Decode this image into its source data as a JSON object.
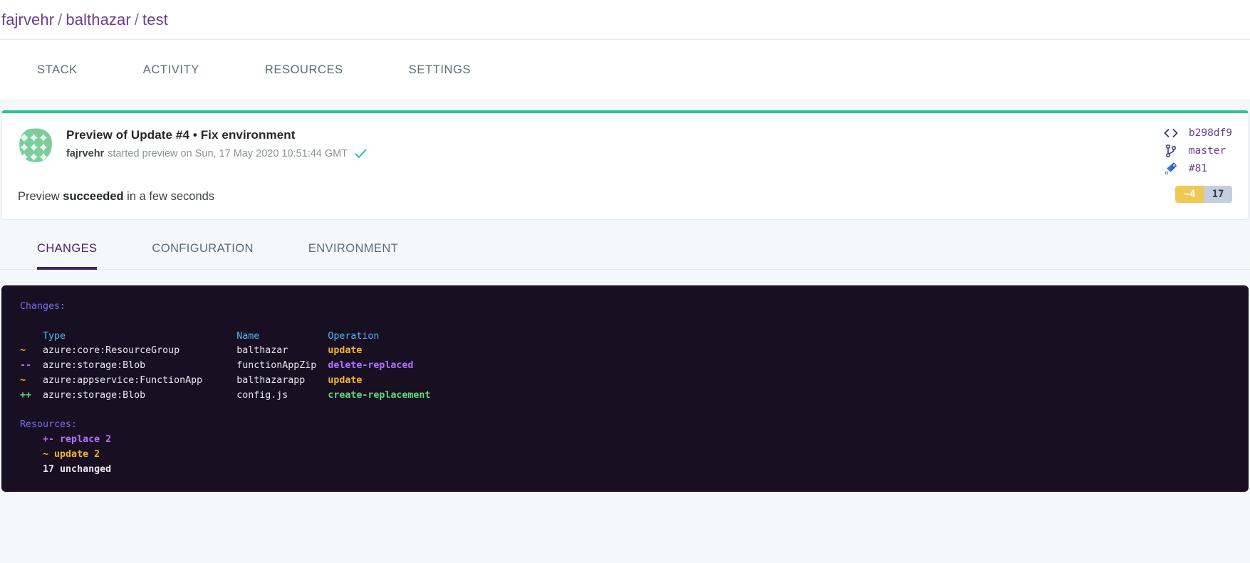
{
  "breadcrumb": {
    "org": "fajrvehr",
    "project": "balthazar",
    "stack": "test",
    "separator": "/"
  },
  "nav": {
    "tabs": [
      {
        "label": "STACK"
      },
      {
        "label": "ACTIVITY"
      },
      {
        "label": "RESOURCES"
      },
      {
        "label": "SETTINGS"
      }
    ]
  },
  "update_card": {
    "accent_color": "#27c69a",
    "title": "Preview of Update #4 • Fix environment",
    "byline": {
      "user": "fajrvehr",
      "text": "started preview on Sun, 17 May 2020 10:51:44 GMT",
      "status_icon": "check-icon"
    },
    "summary": {
      "prefix": "Preview ",
      "status": "succeeded",
      "suffix": " in a few seconds"
    },
    "meta": [
      {
        "icon": "code-brackets-icon",
        "label": "b298df9"
      },
      {
        "icon": "git-branch-icon",
        "label": "master"
      },
      {
        "icon": "azure-devops-icon",
        "label": "#81"
      }
    ],
    "badges": {
      "changed": "~4",
      "unchanged": "17",
      "changed_color": "#f0c854",
      "unchanged_color": "#c4cfdb"
    }
  },
  "subtabs": [
    {
      "label": "CHANGES",
      "active": true
    },
    {
      "label": "CONFIGURATION",
      "active": false
    },
    {
      "label": "ENVIRONMENT",
      "active": false
    }
  ],
  "terminal": {
    "changes_heading": "Changes:",
    "columns": {
      "marker": "",
      "type": "Type",
      "name": "Name",
      "operation": "Operation"
    },
    "rows": [
      {
        "marker": "~",
        "type": "azure:core:ResourceGroup",
        "name": "balthazar",
        "operation": "update",
        "op_style": "update"
      },
      {
        "marker": "--",
        "type": "azure:storage:Blob",
        "name": "functionAppZip",
        "operation": "delete-replaced",
        "op_style": "delete"
      },
      {
        "marker": "~",
        "type": "azure:appservice:FunctionApp",
        "name": "balthazarapp",
        "operation": "update",
        "op_style": "update"
      },
      {
        "marker": "++",
        "type": "azure:storage:Blob",
        "name": "config.js",
        "operation": "create-replacement",
        "op_style": "create"
      }
    ],
    "resources_heading": "Resources:",
    "resources": [
      {
        "marker": "+-",
        "label": "replace",
        "count": "2",
        "style": "delete"
      },
      {
        "marker": "~",
        "label": "update",
        "count": "2",
        "style": "update"
      },
      {
        "marker": "17",
        "label": "unchanged",
        "count": "",
        "style": "plain"
      }
    ]
  }
}
